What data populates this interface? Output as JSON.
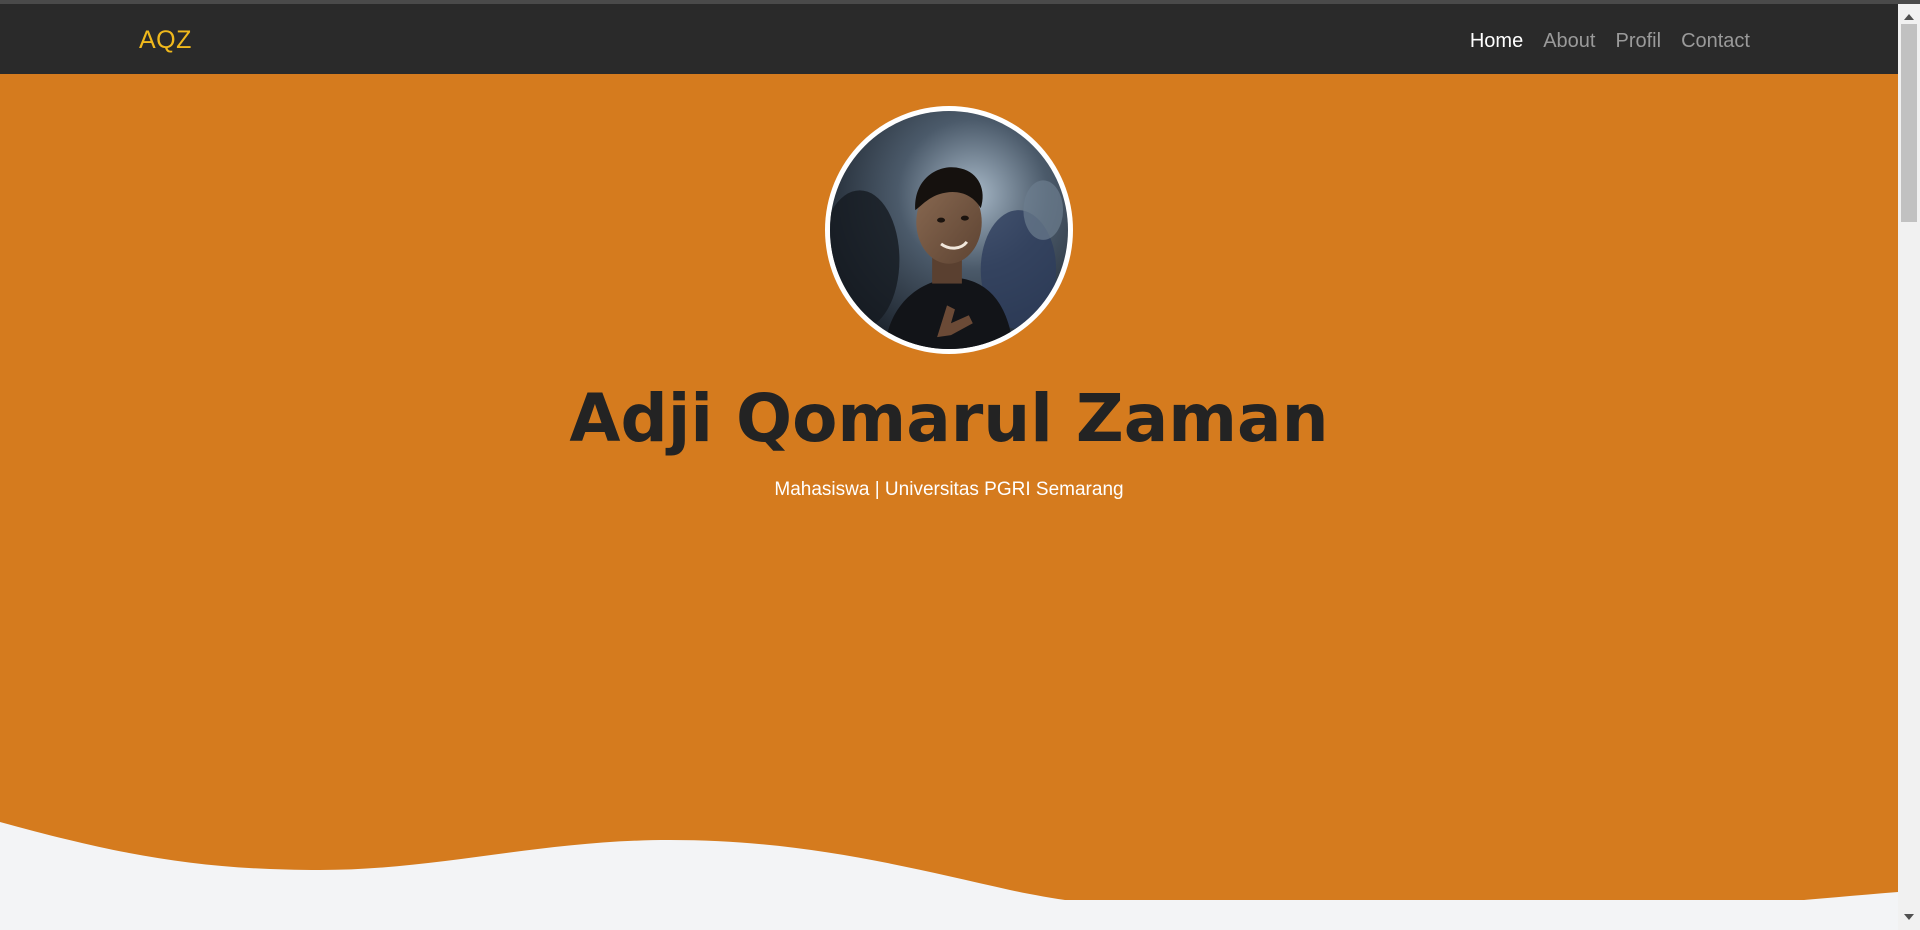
{
  "nav": {
    "brand": "AQZ",
    "links": [
      {
        "label": "Home",
        "active": true
      },
      {
        "label": "About",
        "active": false
      },
      {
        "label": "Profil",
        "active": false
      },
      {
        "label": "Contact",
        "active": false
      }
    ]
  },
  "hero": {
    "name": "Adji Qomarul Zaman",
    "subtitle": "Mahasiswa | Universitas PGRI Semarang",
    "photo_icon": "profile-photo"
  },
  "colors": {
    "navbar_bg": "#2a2a2a",
    "brand": "#f0b91c",
    "hero_bg": "#d57b1e",
    "page_bg": "#f3f4f6",
    "heading": "#232323"
  }
}
